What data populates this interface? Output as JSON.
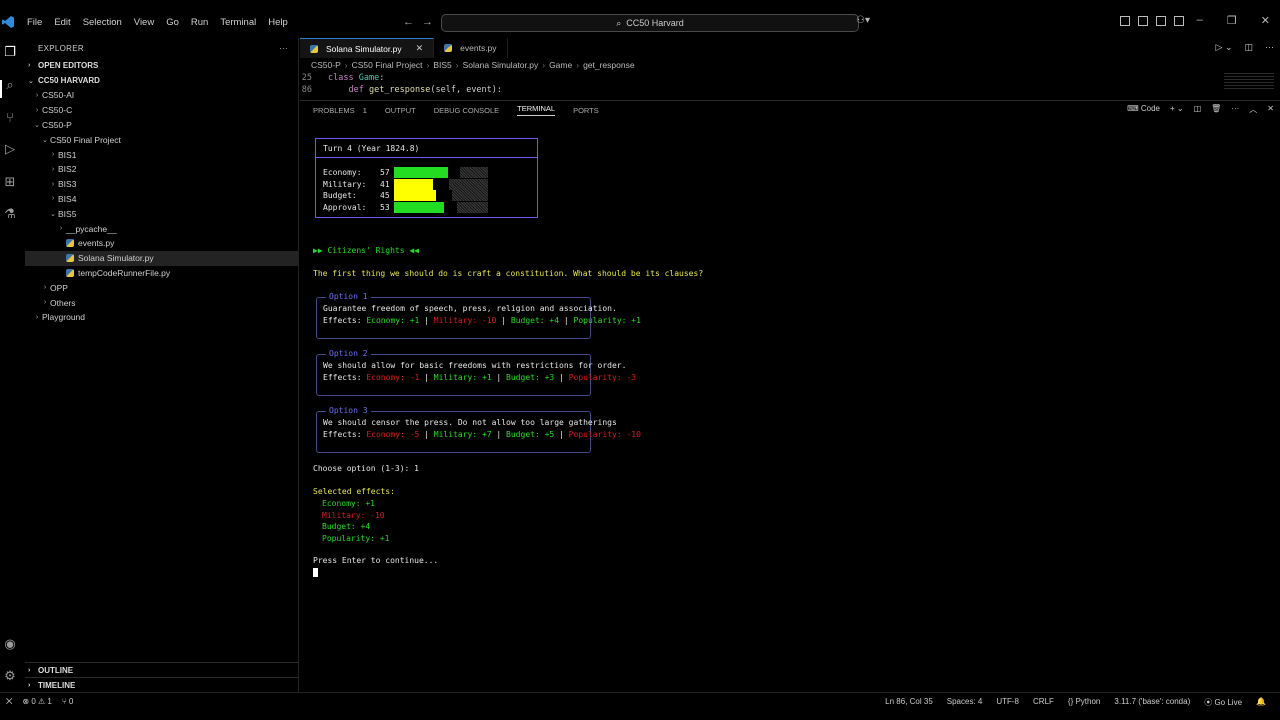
{
  "menu": [
    "File",
    "Edit",
    "Selection",
    "View",
    "Go",
    "Run",
    "Terminal",
    "Help"
  ],
  "command_center": "CC50 Harvard",
  "sidebar": {
    "title": "EXPLORER",
    "open_editors": "OPEN EDITORS",
    "workspace": "CC50 HARVARD",
    "tree": [
      {
        "label": "CS50-AI",
        "level": 1,
        "chev": "›"
      },
      {
        "label": "CS50-C",
        "level": 1,
        "chev": "›"
      },
      {
        "label": "CS50-P",
        "level": 1,
        "chev": "⌄"
      },
      {
        "label": "CS50 Final Project",
        "level": 2,
        "chev": "⌄"
      },
      {
        "label": "BIS1",
        "level": 3,
        "chev": "›"
      },
      {
        "label": "BIS2",
        "level": 3,
        "chev": "›"
      },
      {
        "label": "BIS3",
        "level": 3,
        "chev": "›"
      },
      {
        "label": "BIS4",
        "level": 3,
        "chev": "›"
      },
      {
        "label": "BIS5",
        "level": 3,
        "chev": "⌄"
      },
      {
        "label": "__pycache__",
        "level": 4,
        "chev": "›"
      },
      {
        "label": "events.py",
        "level": 4,
        "chev": "",
        "py": true
      },
      {
        "label": "Solana Simulator.py",
        "level": 4,
        "chev": "",
        "py": true,
        "selected": true
      },
      {
        "label": "tempCodeRunnerFile.py",
        "level": 4,
        "chev": "",
        "py": true
      },
      {
        "label": "OPP",
        "level": 2,
        "chev": "›"
      },
      {
        "label": "Others",
        "level": 2,
        "chev": "›"
      },
      {
        "label": "Playground",
        "level": 1,
        "chev": "›"
      }
    ],
    "outline": "OUTLINE",
    "timeline": "TIMELINE"
  },
  "editor": {
    "tabs": [
      {
        "label": "Solana Simulator.py",
        "active": true
      },
      {
        "label": "events.py",
        "active": false
      }
    ],
    "breadcrumb": [
      "CS50-P",
      "CS50 Final Project",
      "BIS5",
      "Solana Simulator.py",
      "Game",
      "get_response"
    ],
    "code": [
      {
        "ln": "25",
        "kw": "class ",
        "name": "Game",
        "rest": ":"
      },
      {
        "ln": "86",
        "kw": "    def ",
        "name": "get_response",
        "rest": "(self, event):"
      }
    ]
  },
  "panel": {
    "tabs": [
      "PROBLEMS",
      "OUTPUT",
      "DEBUG CONSOLE",
      "TERMINAL",
      "PORTS"
    ],
    "problems_count": "1",
    "active_tab": "TERMINAL",
    "terminal_label": "Code"
  },
  "terminal": {
    "turn_title": "Turn 4 (Year 1824.8)",
    "stats": [
      {
        "label": "Economy:",
        "value": "57",
        "level": 0.57,
        "color": "#22dd22"
      },
      {
        "label": "Military:",
        "value": "41",
        "level": 0.41,
        "color": "#ffff00"
      },
      {
        "label": "Budget:",
        "value": "45",
        "level": 0.45,
        "color": "#ffff00"
      },
      {
        "label": "Approval:",
        "value": "53",
        "level": 0.53,
        "color": "#22dd22"
      }
    ],
    "section_title": "▶▶ Citizens' Rights ◀◀",
    "question": "The first thing we should do is craft a constitution. What should be its clauses?",
    "options": [
      {
        "label": "Option 1",
        "text": "Guarantee freedom of speech, press, religion and association.",
        "effects": [
          {
            "text": "Economy: +1",
            "color": "green"
          },
          {
            "text": "Military: -10",
            "color": "red"
          },
          {
            "text": "Budget: +4",
            "color": "green"
          },
          {
            "text": "Popularity: +1",
            "color": "green"
          }
        ]
      },
      {
        "label": "Option 2",
        "text": "We should allow for basic freedoms with restrictions for order.",
        "effects": [
          {
            "text": "Economy: -1",
            "color": "red"
          },
          {
            "text": "Military: +1",
            "color": "green"
          },
          {
            "text": "Budget: +3",
            "color": "green"
          },
          {
            "text": "Popularity: -3",
            "color": "red"
          }
        ]
      },
      {
        "label": "Option 3",
        "text": "We should censor the press. Do not allow too large gatherings",
        "effects": [
          {
            "text": "Economy: -5",
            "color": "red"
          },
          {
            "text": "Military: +7",
            "color": "green"
          },
          {
            "text": "Budget: +5",
            "color": "green"
          },
          {
            "text": "Popularity: -10",
            "color": "red"
          }
        ]
      }
    ],
    "effects_prefix": "Effects: ",
    "choose_prompt": "Choose option (1-3): 1",
    "selected_title": "Selected effects:",
    "selected_effects": [
      {
        "text": "Economy: +1",
        "color": "green"
      },
      {
        "text": "Military: -10",
        "color": "red"
      },
      {
        "text": "Budget: +4",
        "color": "green"
      },
      {
        "text": "Popularity: +1",
        "color": "green"
      }
    ],
    "continue_prompt": "Press Enter to continue..."
  },
  "statusbar": {
    "errors": "⊗ 0 ⚠ 1",
    "ports": "⑂ 0",
    "position": "Ln 86, Col 35",
    "spaces": "Spaces: 4",
    "encoding": "UTF-8",
    "eol": "CRLF",
    "language": "{} Python",
    "interpreter": "3.11.7 ('base': conda)",
    "golive": "⦿ Go Live"
  }
}
